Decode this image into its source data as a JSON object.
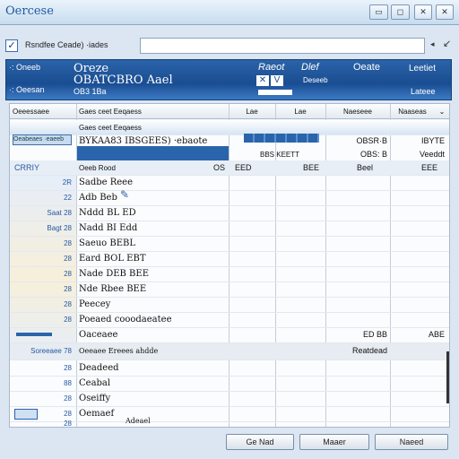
{
  "window": {
    "title": "Oercese",
    "min_label": "▭",
    "max_label": "◻",
    "close_a_label": "✕",
    "close_b_label": "✕"
  },
  "address": {
    "label": "Rsndfee Ceade) ·iades",
    "value": "",
    "caret": "◂",
    "arrow": "↙"
  },
  "banner": {
    "left_line1": "·:  Oneeb",
    "left_line2": "·:  Oeesan",
    "big1": "Oreze",
    "big2": "OBATCBRO Aael",
    "small": "OB3 1Ba",
    "col1": "Raeot",
    "col2": "Dlef",
    "col3": "Oeate",
    "col4": "Leetiet",
    "col4b": "Lateee",
    "mini": "Deseeb",
    "icon1": "✕",
    "icon2": "V"
  },
  "grid": {
    "headers": [
      "Oeeessaee",
      "Gaes ceet Eeqaess",
      "Lae",
      "Lae",
      "Naeseee",
      "Naaseas"
    ],
    "selected_row": {
      "num": "Oeabeaes ·eaeeb",
      "code": "BYKAA83 IBSGEES) ·ebaote",
      "r1": "OBSR·B",
      "r2": "IBYTE"
    },
    "row_b": {
      "num": "",
      "code": "",
      "mid": "BBS  KEETT",
      "r1": "OBS: B",
      "r2": "Veeddt"
    },
    "row_c": {
      "num": "CRRIY",
      "code": "Oeeb Rood",
      "mid2": "OS",
      "r0": "EED",
      "r1": "BEE",
      "r2": "Beel",
      "r3": "EEE"
    },
    "rows": [
      {
        "num": "2R",
        "code": "Sadbe Reee"
      },
      {
        "num": "22",
        "code": "Adb Beb"
      },
      {
        "num": "Saat 28",
        "code": "Nddd BL ED"
      },
      {
        "num": "Bagt 28",
        "code": "Nadd BI Edd"
      },
      {
        "num": "28",
        "code": "Saeuo BEBL"
      },
      {
        "num": "28",
        "code": "Eard BOL EBT"
      },
      {
        "num": "28",
        "code": "Nade DEB BEE"
      },
      {
        "num": "28",
        "code": "Nde Rbee BEE"
      },
      {
        "num": "28",
        "code": "Peecey"
      },
      {
        "num": "28",
        "code": "Poeaed cooodaeatee"
      },
      {
        "num": "",
        "code": "Oaceaee"
      }
    ],
    "mid_row": {
      "r1": "ED BB",
      "r2": "ABE"
    },
    "sep_row": {
      "num": "Soreeaee 78",
      "code": "Oeeaee Ereees ahdde",
      "r1": "Reatdead"
    },
    "sub_rows": [
      {
        "num": "28",
        "code": "Deadeed"
      },
      {
        "num": "88",
        "code": "Ceabal"
      },
      {
        "num": "28",
        "code": "Oseiffy"
      },
      {
        "num": "28",
        "code": "Oemaef"
      },
      {
        "num": "28",
        "code": "Adeael"
      }
    ],
    "combo_caret": "⌄"
  },
  "footer": {
    "next_label": "Ge Nad",
    "finish_label": "Maaer",
    "cancel_label": "Naeed"
  },
  "colors": {
    "accent": "#2a64ab",
    "banner": "#1a4d92",
    "grid_bg": "#fbfcfe"
  }
}
